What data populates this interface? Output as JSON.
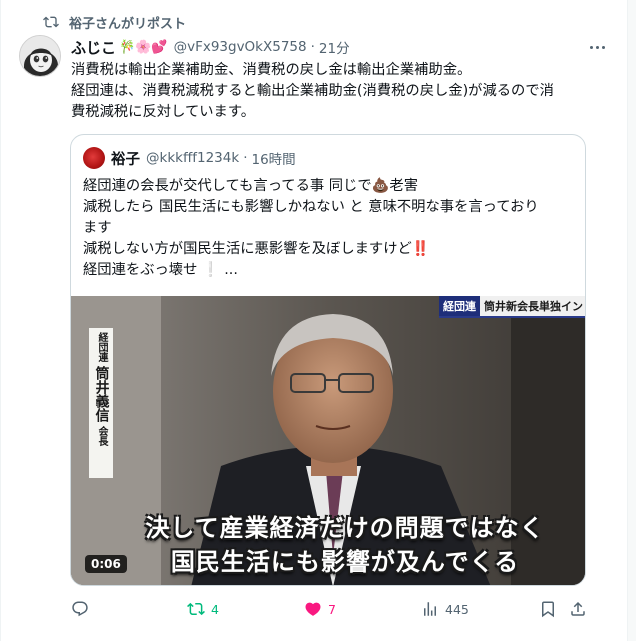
{
  "repost": {
    "label": "裕子さんがリポスト"
  },
  "tweet": {
    "name": "ふじこ",
    "name_emoji": "🎋🌸💕",
    "handle": "@vFx93gvOkX5758",
    "separator": "·",
    "time": "21分",
    "lines": [
      "消費税は輸出企業補助金、消費税の戻し金は輸出企業補助金。",
      "経団連は、消費税減税すると輸出企業補助金(消費税の戻し金)が減るので消",
      "費税減税に反対しています。"
    ]
  },
  "quote": {
    "name": "裕子",
    "handle": "@kkkfff1234k",
    "separator": "·",
    "time": "16時間",
    "lines": [
      "経団連の会長が交代しても言ってる事 同じで💩老害",
      "減税したら 国民生活にも影響しかねない と 意味不明な事を言っており",
      "ます",
      "減税しない方が国民生活に悪影響を及ぼしますけど‼️",
      "経団連をぶっ壊せ ❕ ..."
    ],
    "video": {
      "banner_tag": "経団連",
      "banner_text": "筒井新会長単独イン",
      "sign_top": "経団連",
      "sign_name": "筒井義信",
      "sign_suffix": "会長",
      "caption_line1": "決して産業経済だけの問題ではなく",
      "caption_line2": "国民生活にも影響が及んでくる",
      "duration": "0:06"
    }
  },
  "actions": {
    "reply_count": "",
    "repost_count": "4",
    "like_count": "7",
    "views_count": "445"
  },
  "colors": {
    "text": "#0f1419",
    "secondary": "#536471",
    "repost_green": "#00ba7c",
    "like_pink": "#f91880",
    "border": "#cfd9de"
  },
  "icons": [
    "repost-icon",
    "more-icon",
    "reply-icon",
    "heart-icon",
    "views-icon",
    "bookmark-icon",
    "share-icon"
  ]
}
